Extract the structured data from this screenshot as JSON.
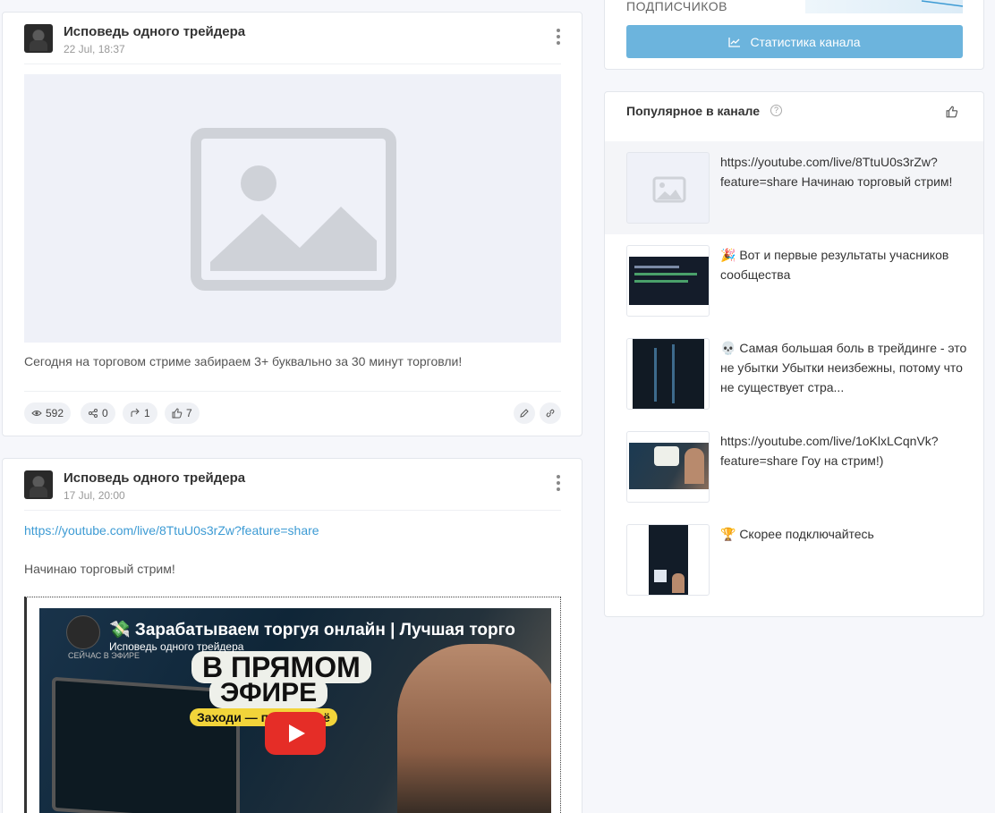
{
  "posts": [
    {
      "channel": "Исповедь одного трейдера",
      "date": "22 Jul, 18:37",
      "text": "Сегодня на торговом стриме забираем 3+ буквально за 30 минут торговли!",
      "views": "592",
      "shares": "0",
      "forwards": "1",
      "likes": "7"
    },
    {
      "channel": "Исповедь одного трейдера",
      "date": "17 Jul, 20:00",
      "link": "https://youtube.com/live/8TtuU0s3rZw?feature=share",
      "text": "Начинаю торговый стрим!",
      "video": {
        "title": "💸 Зарабатываем торгуя онлайн | Лучшая торго",
        "channel": "Исповедь одного трейдера",
        "live_label": "СЕЙЧАС В ЭФИРЕ",
        "big_line1": "В ПРЯМОМ",
        "big_line2": "ЭФИРЕ",
        "yellow": "Заходи — покажу всё"
      }
    }
  ],
  "sidebar": {
    "subscribers_label": "ПОДПИСЧИКОВ",
    "stats_button": "Статистика канала",
    "popular_title": "Популярное в канале",
    "popular": [
      {
        "text": "https://youtube.com/live/8TtuU0s3rZw?feature=share Начинаю торговый стрим!"
      },
      {
        "text": "🎉 Вот и первые результаты учасников сообщества"
      },
      {
        "text": "💀 Самая большая боль в трейдинге - это не убытки Убытки неизбежны, потому что не существует стра..."
      },
      {
        "text": "https://youtube.com/live/1oKlxLCqnVk?feature=share Гоу на стрим!)"
      },
      {
        "text": "🏆 Скорее подключайтесь"
      }
    ]
  },
  "colors": {
    "accent": "#6cb4dd",
    "link": "#3d9bd4",
    "play": "#e52d27"
  }
}
